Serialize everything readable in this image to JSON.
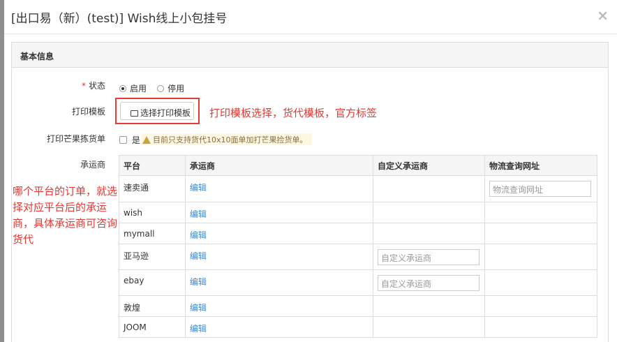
{
  "dialog": {
    "title": "[出口易（新）(test)] Wish线上小包挂号",
    "close_symbol": "×"
  },
  "panel": {
    "heading": "基本信息"
  },
  "form": {
    "status": {
      "label": "状态",
      "required_mark": "*",
      "options": [
        {
          "label": "启用",
          "selected": true
        },
        {
          "label": "停用",
          "selected": false
        }
      ]
    },
    "print_template": {
      "label": "打印模板",
      "button_label": "选择打印模板",
      "button_icon": "printer-icon"
    },
    "mango_pick": {
      "label": "打印芒果拣货单",
      "checkbox_label": "是",
      "checked": false,
      "notice": "目前只支持货代10x10面单加打芒果捡货单。",
      "notice_icon": "warning-icon"
    },
    "carrier": {
      "label": "承运商"
    }
  },
  "carrier_table": {
    "headers": [
      "平台",
      "承运商",
      "自定义承运商",
      "物流查询网址"
    ],
    "rows": [
      {
        "platform": "速卖通",
        "carrier_link": "编辑",
        "custom_placeholder": "",
        "url_placeholder": "物流查询网址"
      },
      {
        "platform": "wish",
        "carrier_link": "编辑",
        "custom_placeholder": "",
        "url_placeholder": ""
      },
      {
        "platform": "mymall",
        "carrier_link": "编辑",
        "custom_placeholder": "",
        "url_placeholder": ""
      },
      {
        "platform": "亚马逊",
        "carrier_link": "编辑",
        "custom_placeholder": "自定义承运商",
        "url_placeholder": ""
      },
      {
        "platform": "ebay",
        "carrier_link": "编辑",
        "custom_placeholder": "自定义承运商",
        "url_placeholder": ""
      },
      {
        "platform": "敦煌",
        "carrier_link": "编辑",
        "custom_placeholder": "",
        "url_placeholder": ""
      },
      {
        "platform": "JOOM",
        "carrier_link": "编辑",
        "custom_placeholder": "",
        "url_placeholder": ""
      }
    ]
  },
  "annotations": {
    "template_note": "打印模板选择，货代模板，官方标签",
    "carrier_note": "哪个平台的订单，就选择对应平台后的承运商，具体承运商可咨询货代"
  },
  "colors": {
    "annotation_red": "#e53935",
    "link_blue": "#3a8bd6",
    "notice_bg": "#fcf8e3",
    "notice_text": "#8a6d3b"
  }
}
